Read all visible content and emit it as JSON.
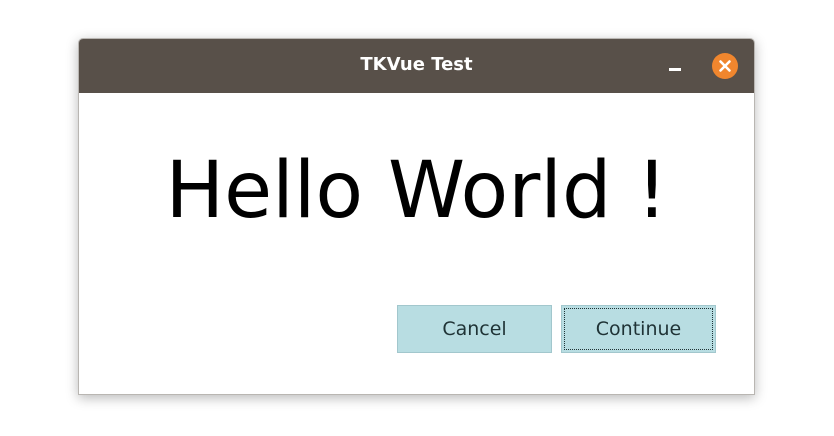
{
  "window": {
    "title": "TKVue Test",
    "titlebar_color": "#585049",
    "close_button_color": "#f0862e"
  },
  "content": {
    "heading": "Hello World !"
  },
  "buttons": {
    "cancel_label": "Cancel",
    "continue_label": "Continue",
    "button_color": "#b8dde2"
  },
  "icons": {
    "minimize": "minimize-icon",
    "close": "close-icon"
  }
}
